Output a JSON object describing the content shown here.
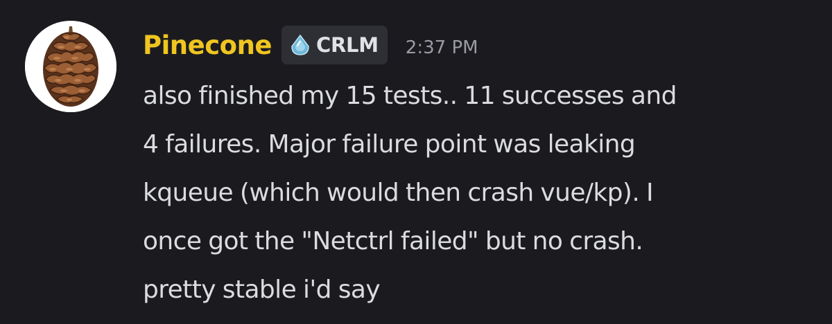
{
  "message": {
    "author": "Pinecone",
    "author_color": "#f0c520",
    "avatar_icon": "pinecone-avatar-icon",
    "tag": {
      "icon": "diamond-drop-icon",
      "label": "CRLM"
    },
    "timestamp": "2:37 PM",
    "lines": [
      "also finished my 15 tests.. 11 successes and",
      "4 failures. Major failure point was leaking",
      "kqueue (which would then crash vue/kp). I",
      "once got the \"Netctrl failed\" but no crash.",
      "pretty stable i'd say"
    ]
  }
}
